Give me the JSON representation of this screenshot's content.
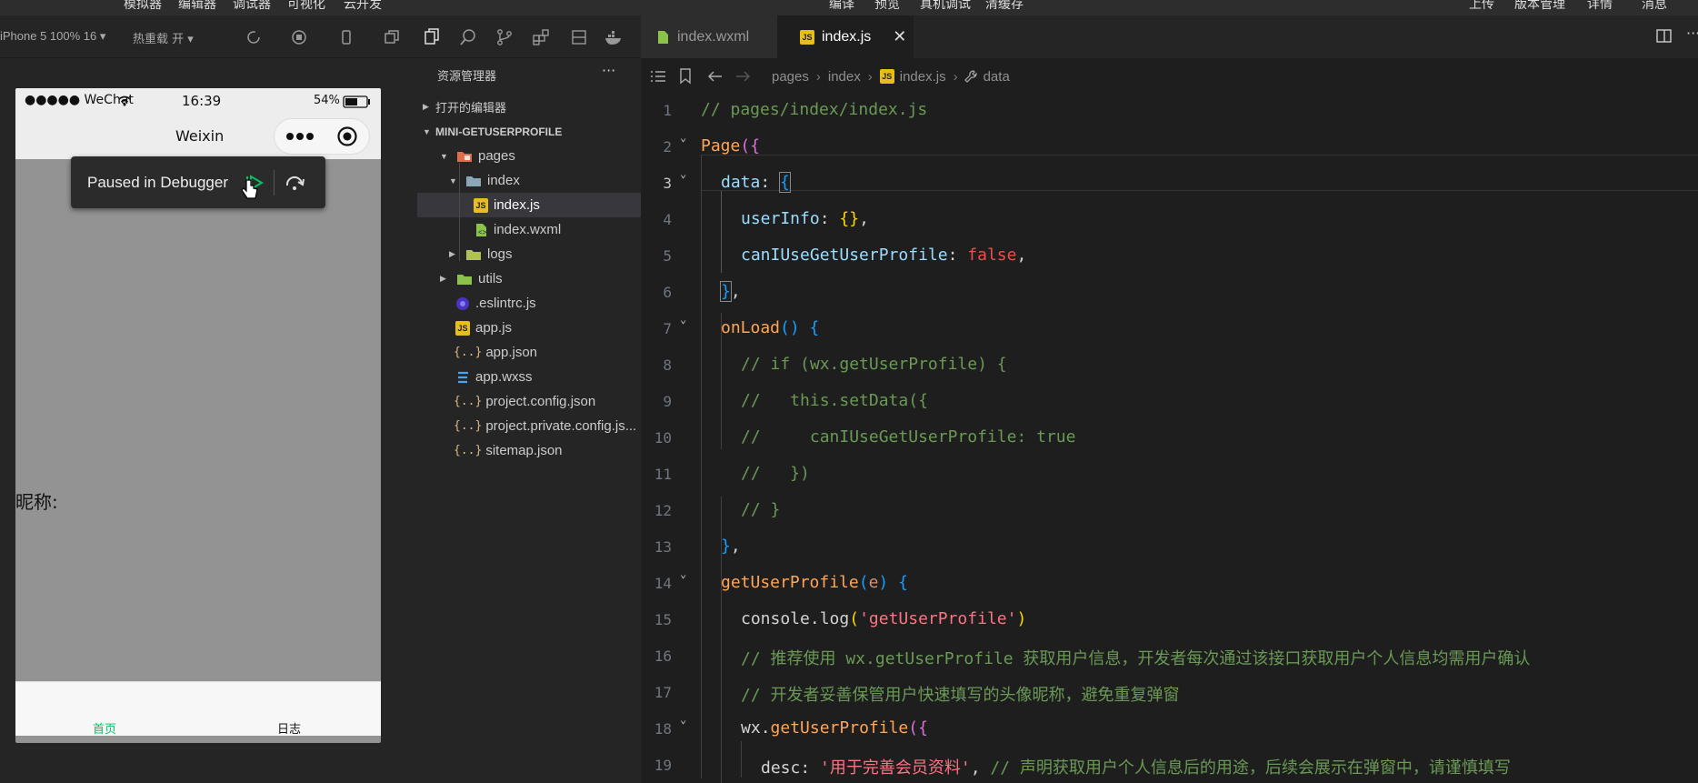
{
  "menubar": {
    "items_left": [
      "模拟器",
      "编辑器",
      "调试器",
      "可视化",
      "云开发"
    ],
    "items_center": [
      "编译",
      "预览",
      "真机调试",
      "清缓存"
    ],
    "items_right": [
      "上传",
      "版本管理",
      "详情",
      "消息"
    ]
  },
  "toolbar": {
    "device": "iPhone 5 100% 16 ▾",
    "hotreload": "热重载 开 ▾"
  },
  "simulator": {
    "carrier": "●●●●● WeChat",
    "time": "16:39",
    "battery": "54%",
    "nav_title": "Weixin",
    "debugger_text": "Paused in Debugger",
    "nickname_label": "昵称:",
    "tab_home": "首页",
    "tab_logs": "日志",
    "tab_home_color": "#07c160"
  },
  "explorer": {
    "title": "资源管理器",
    "menu": "···",
    "open_editors": "打开的编辑器",
    "project": "MINI-GETUSERPROFILE",
    "items": [
      {
        "label": "pages",
        "type": "folder-open"
      },
      {
        "label": "index",
        "type": "folder-open"
      },
      {
        "label": "index.js",
        "type": "js"
      },
      {
        "label": "index.wxml",
        "type": "wxml"
      },
      {
        "label": "logs",
        "type": "folder"
      },
      {
        "label": "utils",
        "type": "folder"
      },
      {
        "label": ".eslintrc.js",
        "type": "eslint"
      },
      {
        "label": "app.js",
        "type": "js"
      },
      {
        "label": "app.json",
        "type": "json"
      },
      {
        "label": "app.wxss",
        "type": "wxss"
      },
      {
        "label": "project.config.json",
        "type": "json"
      },
      {
        "label": "project.private.config.js...",
        "type": "json"
      },
      {
        "label": "sitemap.json",
        "type": "json"
      }
    ]
  },
  "editor": {
    "tabs": [
      {
        "label": "index.wxml",
        "active": false
      },
      {
        "label": "index.js",
        "active": true
      }
    ],
    "breadcrumb": [
      "pages",
      "index",
      "index.js",
      "data"
    ],
    "line_numbers": [
      "1",
      "2",
      "3",
      "4",
      "5",
      "6",
      "7",
      "8",
      "9",
      "10",
      "11",
      "12",
      "13",
      "14",
      "15",
      "16",
      "17",
      "18",
      "19"
    ],
    "current_line": "3",
    "code": {
      "l1": "// pages/index/index.js",
      "l2a": "Page",
      "l2b": "({",
      "l3a": "data",
      "l3b": ": ",
      "l3c": "{",
      "l4a": "userInfo",
      "l4b": ": ",
      "l4c": "{}",
      "l4d": ",",
      "l5a": "canIUseGetUserProfile",
      "l5b": ": ",
      "l5c": "false",
      "l5d": ",",
      "l6a": "}",
      "l6b": ",",
      "l7a": "onLoad",
      "l7b": "() ",
      "l7c": "{",
      "l8": "// if (wx.getUserProfile) {",
      "l9": "//   this.setData({",
      "l10": "//     canIUseGetUserProfile: true",
      "l11": "//   })",
      "l12": "// }",
      "l13a": "}",
      "l13b": ",",
      "l14a": "getUserProfile",
      "l14b": "(",
      "l14c": "e",
      "l14d": ") ",
      "l14e": "{",
      "l15a": "console",
      "l15b": ".",
      "l15c": "log",
      "l15d": "(",
      "l15e": "'getUserProfile'",
      "l15f": ")",
      "l16": "// 推荐使用 wx.getUserProfile 获取用户信息，开发者每次通过该接口获取用户个人信息均需用户确认",
      "l17": "// 开发者妥善保管用户快速填写的头像昵称，避免重复弹窗",
      "l18a": "wx",
      "l18b": ".",
      "l18c": "getUserProfile",
      "l18d": "({",
      "l19a": "desc",
      "l19b": ": ",
      "l19c": "'用于完善会员资料'",
      "l19d": ", ",
      "l19e": "// 声明获取用户个人信息后的用途，后续会展示在弹窗中，请谨慎填写"
    }
  }
}
